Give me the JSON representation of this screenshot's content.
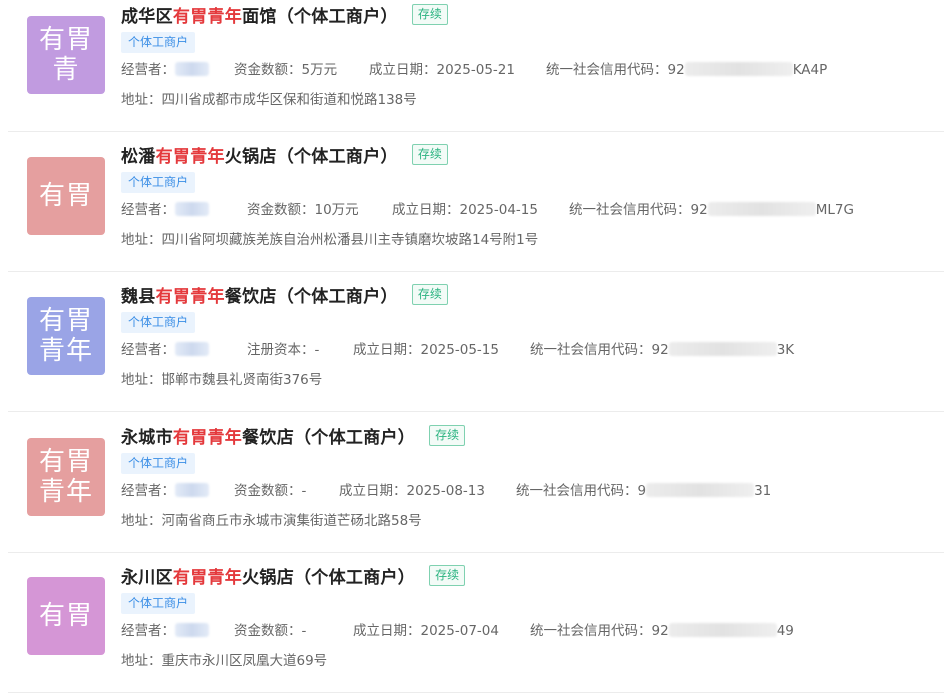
{
  "labels": {
    "operator": "经营者：",
    "capital": "资金数额：",
    "registered_capital": "注册资本：",
    "founded": "成立日期：",
    "credit_code": "统一社会信用代码：",
    "address": "地址："
  },
  "companies": [
    {
      "logo_text": "有胃青",
      "logo_color": "#c19be0",
      "name_prefix": "成华区",
      "name_highlight": "有胃青年",
      "name_suffix": "面馆（个体工商户）",
      "status": "存续",
      "tag": "个体工商户",
      "capital_label": "资金数额：",
      "capital_value": "5万元",
      "founded": "2025-05-21",
      "code_start": "92",
      "code_end": "KA4P",
      "address": "四川省成都市成华区保和街道和悦路138号"
    },
    {
      "logo_text": "有胃",
      "logo_color": "#e59f9f",
      "name_prefix": "松潘",
      "name_highlight": "有胃青年",
      "name_suffix": "火锅店（个体工商户）",
      "status": "存续",
      "tag": "个体工商户",
      "capital_label": "资金数额：",
      "capital_value": "10万元",
      "founded": "2025-04-15",
      "code_start": "92",
      "code_end": "ML7G",
      "address": "四川省阿坝藏族羌族自治州松潘县川主寺镇磨坎坡路14号附1号"
    },
    {
      "logo_text": "有胃青年",
      "logo_color": "#9aa4e6",
      "name_prefix": "魏县",
      "name_highlight": "有胃青年",
      "name_suffix": "餐饮店（个体工商户）",
      "status": "存续",
      "tag": "个体工商户",
      "capital_label": "注册资本：",
      "capital_value": "-",
      "founded": "2025-05-15",
      "code_start": "92",
      "code_end": "3K",
      "address": "邯郸市魏县礼贤南街376号"
    },
    {
      "logo_text": "有胃青年",
      "logo_color": "#e59f9f",
      "name_prefix": "永城市",
      "name_highlight": "有胃青年",
      "name_suffix": "餐饮店（个体工商户）",
      "status": "存续",
      "tag": "个体工商户",
      "capital_label": "资金数额：",
      "capital_value": "-",
      "founded": "2025-08-13",
      "code_start": "9",
      "code_end": "31",
      "address": "河南省商丘市永城市演集街道芒砀北路58号"
    },
    {
      "logo_text": "有胃",
      "logo_color": "#d596d6",
      "name_prefix": "永川区",
      "name_highlight": "有胃青年",
      "name_suffix": "火锅店（个体工商户）",
      "status": "存续",
      "tag": "个体工商户",
      "capital_label": "资金数额：",
      "capital_value": "-",
      "founded": "2025-07-04",
      "code_start": "92",
      "code_end": "49",
      "address": "重庆市永川区凤凰大道69号"
    }
  ]
}
